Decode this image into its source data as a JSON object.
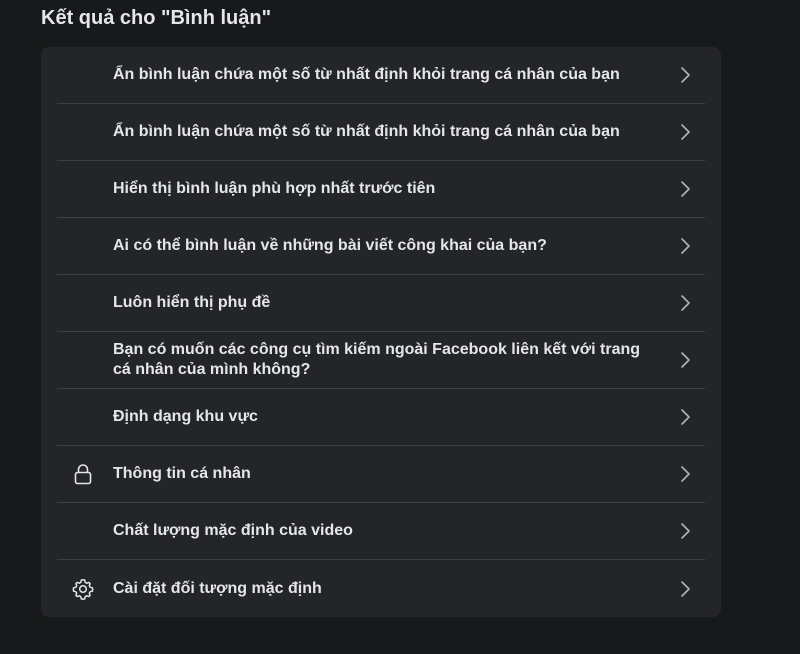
{
  "header": {
    "title": "Kết quả cho \"Bình luận\""
  },
  "results": [
    {
      "label": "Ẩn bình luận chứa một số từ nhất định khỏi trang cá nhân của bạn",
      "icon": ""
    },
    {
      "label": "Ẩn bình luận chứa một số từ nhất định khỏi trang cá nhân của bạn",
      "icon": ""
    },
    {
      "label": "Hiển thị bình luận phù hợp nhất trước tiên",
      "icon": ""
    },
    {
      "label": "Ai có thể bình luận về những bài viết công khai của bạn?",
      "icon": ""
    },
    {
      "label": "Luôn hiển thị phụ đề",
      "icon": ""
    },
    {
      "label": "Bạn có muốn các công cụ tìm kiếm ngoài Facebook liên kết với trang cá nhân của mình không?",
      "icon": ""
    },
    {
      "label": "Định dạng khu vực",
      "icon": ""
    },
    {
      "label": "Thông tin cá nhân",
      "icon": "lock-icon"
    },
    {
      "label": "Chất lượng mặc định của video",
      "icon": ""
    },
    {
      "label": "Cài đặt đối tượng mặc định",
      "icon": "gear-icon"
    }
  ],
  "colors": {
    "background": "#18191a",
    "card": "#242526",
    "divider": "#3e4042",
    "text": "#e4e6eb",
    "chevron": "#b0b3b8"
  }
}
